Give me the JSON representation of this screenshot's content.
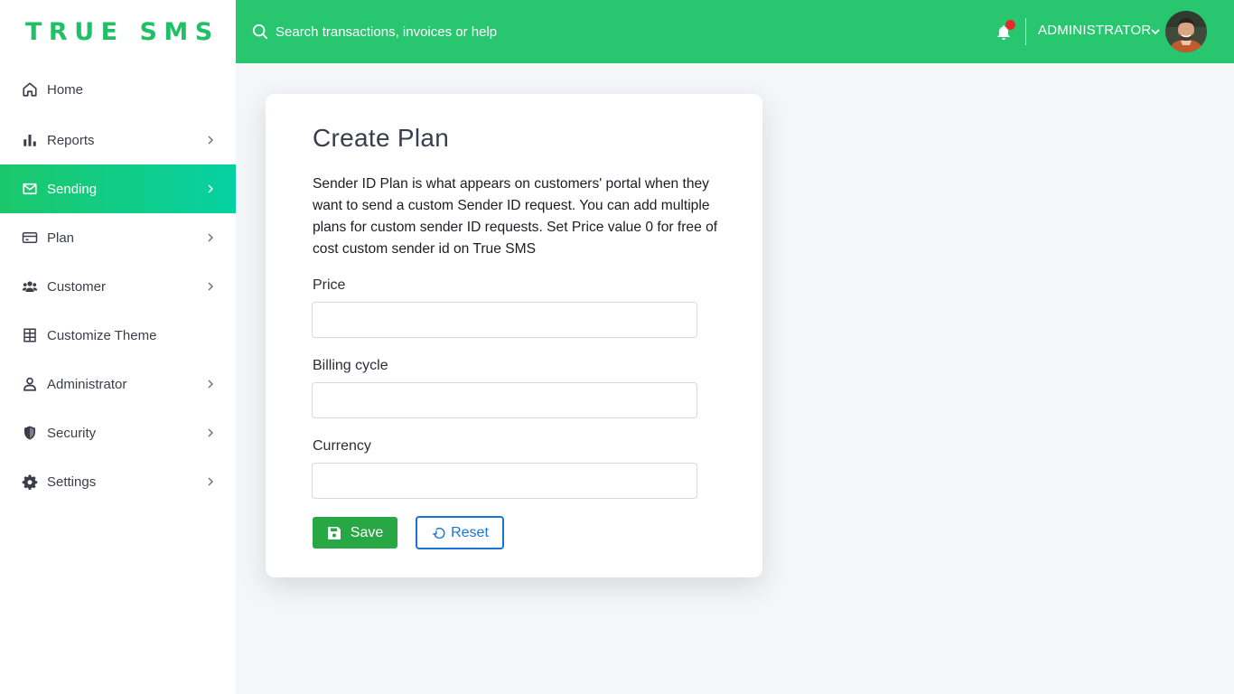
{
  "app": {
    "logo_text": "TRUE SMS",
    "brand_color": "#28c76f"
  },
  "sidebar": {
    "items": [
      {
        "label": "Home",
        "icon": "home-icon",
        "has_submenu": false,
        "active": false
      },
      {
        "label": "Reports",
        "icon": "bar-chart-icon",
        "has_submenu": true,
        "active": false
      },
      {
        "label": "Sending",
        "icon": "envelope-icon",
        "has_submenu": true,
        "active": true
      },
      {
        "label": "Plan",
        "icon": "credit-card-icon",
        "has_submenu": true,
        "active": false
      },
      {
        "label": "Customer",
        "icon": "users-icon",
        "has_submenu": true,
        "active": false
      },
      {
        "label": "Customize Theme",
        "icon": "grid-icon",
        "has_submenu": false,
        "active": false
      },
      {
        "label": "Administrator",
        "icon": "user-icon",
        "has_submenu": true,
        "active": false
      },
      {
        "label": "Security",
        "icon": "shield-icon",
        "has_submenu": true,
        "active": false
      },
      {
        "label": "Settings",
        "icon": "gear-icon",
        "has_submenu": true,
        "active": false
      }
    ]
  },
  "header": {
    "search_placeholder": "Search transactions, invoices or help",
    "notification_icon": "bell-icon",
    "has_unread_notifications": true,
    "user_name": "ADMINISTRATOR"
  },
  "form": {
    "title": "Create Plan",
    "description": "Sender ID Plan is what appears on customers' portal when they want to send a custom Sender ID request. You can add multiple plans for custom sender ID requests. Set Price value 0 for free of cost custom sender id on True SMS",
    "fields": [
      {
        "label": "Price",
        "value": ""
      },
      {
        "label": "Billing cycle",
        "value": ""
      },
      {
        "label": "Currency",
        "value": ""
      }
    ],
    "save_label": "Save",
    "reset_label": "Reset"
  },
  "colors": {
    "accent": "#28c76f",
    "active_gradient_start": "#1cc76a",
    "active_gradient_end": "#06d1a2",
    "save_button": "#28a745",
    "reset_button": "#1a73d6",
    "notification_dot": "#ea2a2a"
  }
}
